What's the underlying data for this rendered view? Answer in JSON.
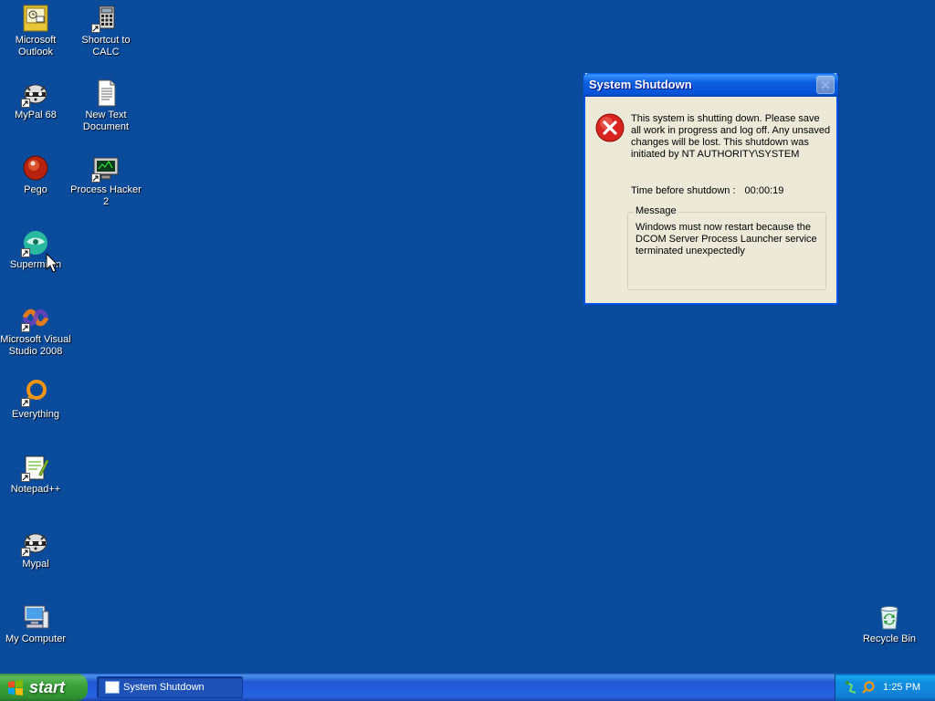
{
  "desktop": {
    "icons": [
      {
        "label": "Microsoft Outlook",
        "icon": "outlook-icon"
      },
      {
        "label": "Shortcut to CALC",
        "icon": "calculator-icon"
      },
      {
        "label": "MyPal 68",
        "icon": "raccoon-icon"
      },
      {
        "label": "New Text Document",
        "icon": "text-document-icon"
      },
      {
        "label": "Pego",
        "icon": "pego-icon"
      },
      {
        "label": "Process Hacker 2",
        "icon": "process-hacker-icon"
      },
      {
        "label": "Supermium",
        "icon": "supermium-icon"
      },
      {
        "label": "Microsoft Visual Studio 2008",
        "icon": "visual-studio-icon"
      },
      {
        "label": "Everything",
        "icon": "everything-icon"
      },
      {
        "label": "Notepad++",
        "icon": "notepadpp-icon"
      },
      {
        "label": "Mypal",
        "icon": "raccoon-icon"
      },
      {
        "label": "My Computer",
        "icon": "my-computer-icon"
      },
      {
        "label": "Recycle Bin",
        "icon": "recycle-bin-icon"
      }
    ]
  },
  "dialog": {
    "title": "System Shutdown",
    "message": "This system is shutting down. Please save all work in progress and log off. Any unsaved changes will be lost. This shutdown was initiated by NT AUTHORITY\\SYSTEM",
    "time_label": "Time before shutdown :",
    "time_value": "00:00:19",
    "group_label": "Message",
    "group_message": "Windows must now restart because the DCOM Server Process Launcher service terminated unexpectedly"
  },
  "taskbar": {
    "start_label": "start",
    "task_label": "System Shutdown",
    "clock": "1:25 PM"
  },
  "colors": {
    "desktop_bg": "#0a4b9b",
    "error_red": "#d8231f"
  }
}
